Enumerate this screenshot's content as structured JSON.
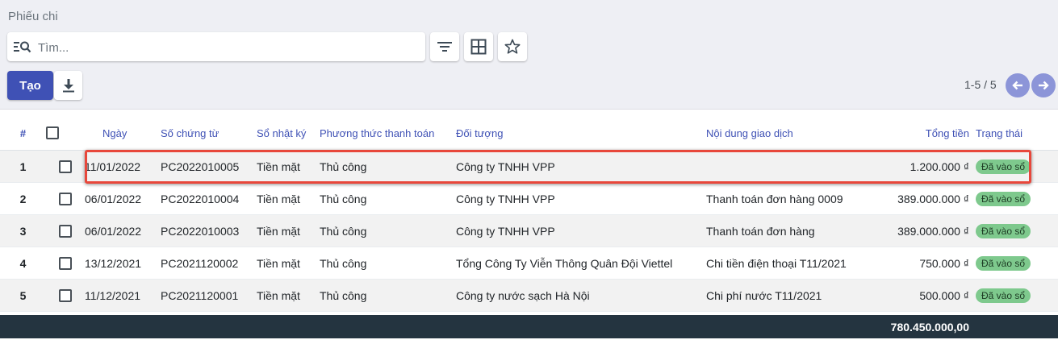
{
  "breadcrumb": "Phiếu chi",
  "search": {
    "placeholder": "Tìm...",
    "value": ""
  },
  "buttons": {
    "create": "Tạo"
  },
  "pager": {
    "value": "1-5 / 5"
  },
  "columns": {
    "num": "#",
    "date": "Ngày",
    "doc_no": "Số chứng từ",
    "journal": "Sổ nhật ký",
    "payment_method": "Phương thức thanh toán",
    "partner": "Đối tượng",
    "description": "Nội dung giao dịch",
    "total": "Tổng tiền",
    "status": "Trạng thái"
  },
  "rows": [
    {
      "num": "1",
      "date": "11/01/2022",
      "doc_no": "PC2022010005",
      "journal": "Tiền mặt",
      "payment_method": "Thủ công",
      "partner": "Công ty TNHH VPP",
      "description": "",
      "total": "1.200.000 ₫",
      "status": "Đã vào sổ"
    },
    {
      "num": "2",
      "date": "06/01/2022",
      "doc_no": "PC2022010004",
      "journal": "Tiền mặt",
      "payment_method": "Thủ công",
      "partner": "Công ty TNHH VPP",
      "description": "Thanh toán đơn hàng 0009",
      "total": "389.000.000 ₫",
      "status": "Đã vào sổ"
    },
    {
      "num": "3",
      "date": "06/01/2022",
      "doc_no": "PC2022010003",
      "journal": "Tiền mặt",
      "payment_method": "Thủ công",
      "partner": "Công ty TNHH VPP",
      "description": "Thanh toán đơn hàng",
      "total": "389.000.000 ₫",
      "status": "Đã vào sổ"
    },
    {
      "num": "4",
      "date": "13/12/2021",
      "doc_no": "PC2021120002",
      "journal": "Tiền mặt",
      "payment_method": "Thủ công",
      "partner": "Tổng Công Ty Viễn Thông Quân Đội Viettel",
      "description": "Chi tiền điện thoại T11/2021",
      "total": "750.000 ₫",
      "status": "Đã vào sổ"
    },
    {
      "num": "5",
      "date": "11/12/2021",
      "doc_no": "PC2021120001",
      "journal": "Tiền mặt",
      "payment_method": "Thủ công",
      "partner": "Công ty nước sạch Hà Nội",
      "description": "Chi phí nước T11/2021",
      "total": "500.000 ₫",
      "status": "Đã vào sổ"
    }
  ],
  "footer": {
    "total": "780.450.000,00"
  },
  "colors": {
    "primary": "#3f51b5",
    "highlight": "#e8473b",
    "badge": "#7ec98d",
    "footer": "#243440",
    "pager": "#8c95d8"
  },
  "icons": [
    "search-panel-icon",
    "filter-icon",
    "grid-icon",
    "star-icon",
    "download-icon",
    "arrow-left-icon",
    "arrow-right-icon"
  ]
}
